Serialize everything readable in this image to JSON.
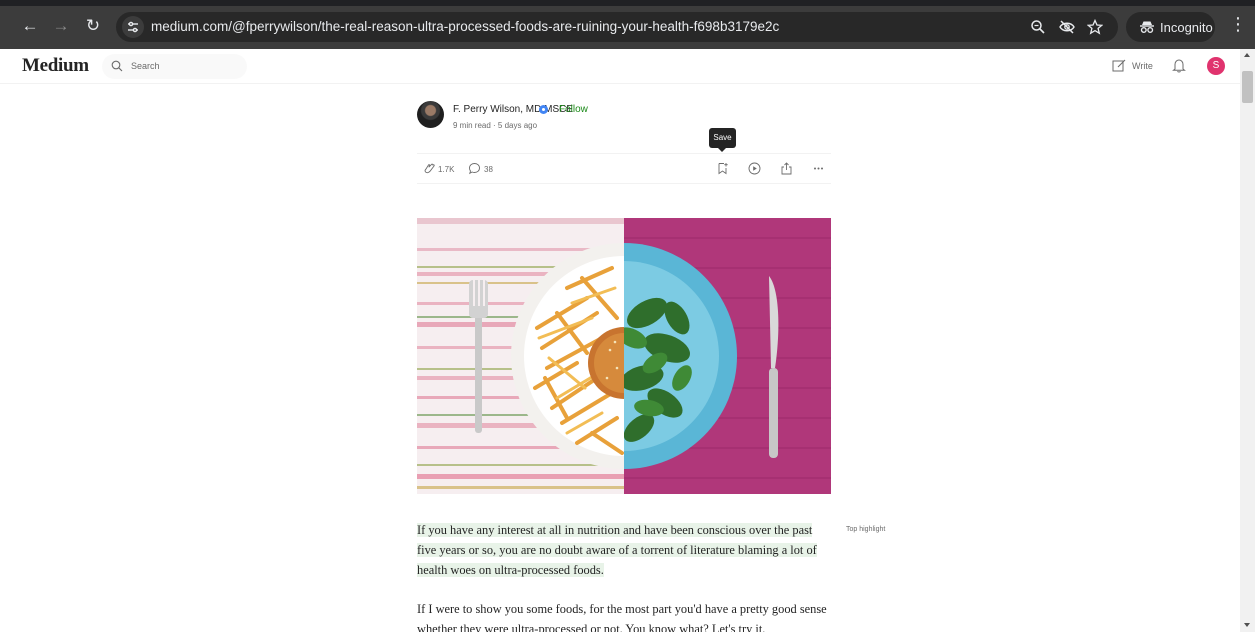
{
  "browser": {
    "url": "medium.com/@fperrywilson/the-real-reason-ultra-processed-foods-are-ruining-your-health-f698b3179e2c",
    "incognito_label": "Incognito"
  },
  "header": {
    "logo": "Medium",
    "search_placeholder": "Search",
    "write_label": "Write",
    "avatar_initial": "S"
  },
  "author": {
    "name": "F. Perry Wilson, MD MSCE",
    "separator": "·",
    "follow_label": "Follow",
    "meta": "9 min read  ·  5 days ago"
  },
  "actions": {
    "claps": "1.7K",
    "responses": "38",
    "save_tooltip": "Save"
  },
  "article": {
    "paragraphs": [
      "If you have any interest at all in nutrition and have been conscious over the past five years or so, you are no doubt aware of a torrent of literature blaming a lot of health woes on ultra-processed foods.",
      "If I were to show you some foods, for the most part you'd have a pretty good sense whether they were ultra-processed or not. You know what? Let's try it."
    ],
    "top_highlight_label": "Top highlight"
  }
}
